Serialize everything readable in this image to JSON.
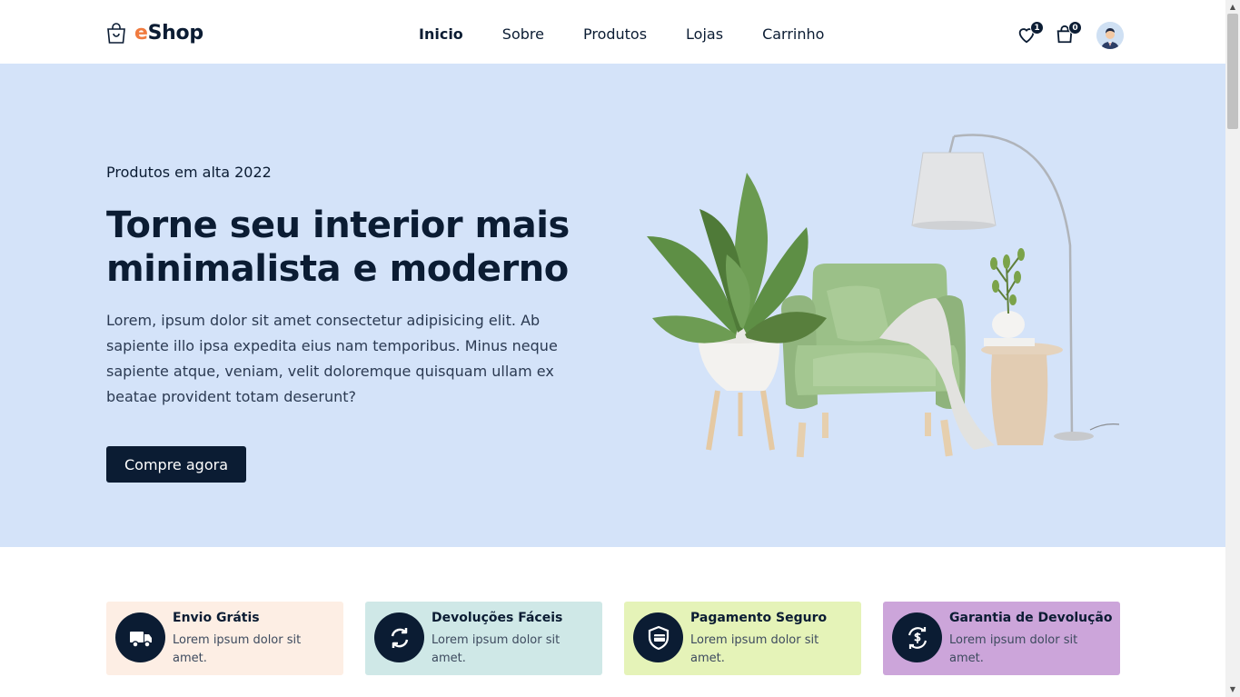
{
  "brand": {
    "prefix": "e",
    "name": "Shop",
    "accent": "#f07b3f"
  },
  "nav": [
    {
      "label": "Inicio",
      "active": true
    },
    {
      "label": "Sobre",
      "active": false
    },
    {
      "label": "Produtos",
      "active": false
    },
    {
      "label": "Lojas",
      "active": false
    },
    {
      "label": "Carrinho",
      "active": false
    }
  ],
  "header_icons": {
    "wishlist": {
      "icon": "heart-icon",
      "count": "1"
    },
    "cart": {
      "icon": "shopping-bag-icon",
      "count": "0"
    },
    "avatar": {
      "icon": "user-avatar"
    }
  },
  "hero": {
    "subtitle": "Produtos em alta 2022",
    "title": "Torne seu interior mais minimalista e moderno",
    "description": "Lorem, ipsum dolor sit amet consectetur adipisicing elit. Ab sapiente illo ipsa expedita eius nam temporibus. Minus neque sapiente atque, veniam, velit doloremque quisquam ullam ex beatae provident totam deserunt?",
    "cta": "Compre agora",
    "background": "#d4e3f9"
  },
  "features": [
    {
      "title": "Envio Grátis",
      "text": "Lorem ipsum dolor sit amet.",
      "icon": "truck-icon",
      "color": "#fdeee4"
    },
    {
      "title": "Devoluções Fáceis",
      "text": "Lorem ipsum dolor sit amet.",
      "icon": "refresh-icon",
      "color": "#cfe8e7"
    },
    {
      "title": "Pagamento Seguro",
      "text": "Lorem ipsum dolor sit amet.",
      "icon": "shield-card-icon",
      "color": "#e5f3b8"
    },
    {
      "title": "Garantia de Devolução",
      "text": "Lorem ipsum dolor sit amet.",
      "icon": "money-back-icon",
      "color": "#cca5da"
    }
  ]
}
